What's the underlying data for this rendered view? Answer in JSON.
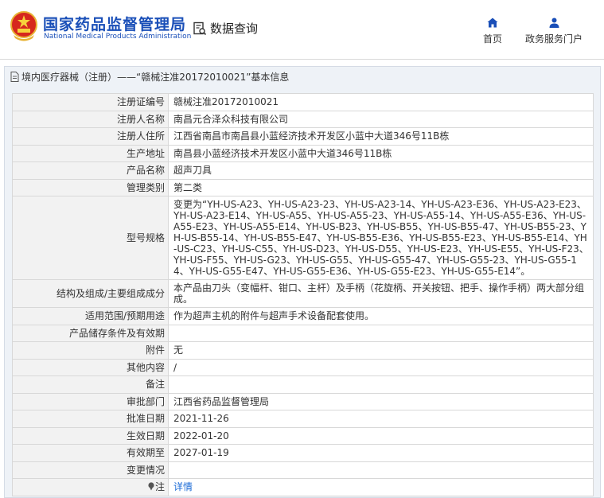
{
  "header": {
    "site_name_cn": "国家药品监督管理局",
    "site_name_en": "National Medical Products Administration",
    "search_label": "数据查询",
    "nav": [
      {
        "label": "首页",
        "icon": "home-icon"
      },
      {
        "label": "政务服务门户",
        "icon": "user-icon"
      }
    ]
  },
  "breadcrumb": {
    "text": "境内医疗器械（注册）——“赣械注准20172010021”基本信息"
  },
  "fields": [
    {
      "label": "注册证编号",
      "value": "赣械注准20172010021"
    },
    {
      "label": "注册人名称",
      "value": "南昌元合泽众科技有限公司"
    },
    {
      "label": "注册人住所",
      "value": "江西省南昌市南昌县小蓝经济技术开发区小蓝中大道346号11B栋"
    },
    {
      "label": "生产地址",
      "value": "南昌县小蓝经济技术开发区小蓝中大道346号11B栋"
    },
    {
      "label": "产品名称",
      "value": "超声刀具"
    },
    {
      "label": "管理类别",
      "value": "第二类"
    },
    {
      "label": "型号规格",
      "value": "变更为“YH-US-A23、YH-US-A23-23、YH-US-A23-14、YH-US-A23-E36、YH-US-A23-E23、YH-US-A23-E14、YH-US-A55、YH-US-A55-23、YH-US-A55-14、YH-US-A55-E36、YH-US-A55-E23、YH-US-A55-E14、YH-US-B23、YH-US-B55、YH-US-B55-47、YH-US-B55-23、YH-US-B55-14、YH-US-B55-E47、YH-US-B55-E36、YH-US-B55-E23、YH-US-B55-E14、YH-US-C23、YH-US-C55、YH-US-D23、YH-US-D55、YH-US-E23、YH-US-E55、YH-US-F23、YH-US-F55、YH-US-G23、YH-US-G55、YH-US-G55-47、YH-US-G55-23、YH-US-G55-14、YH-US-G55-E47、YH-US-G55-E36、YH-US-G55-E23、YH-US-G55-E14”。"
    },
    {
      "label": "结构及组成/主要组成成分",
      "value": "本产品由刀头（变幅杆、钳口、主杆）及手柄（花旋柄、开关按钮、把手、操作手柄）两大部分组成。"
    },
    {
      "label": "适用范围/预期用途",
      "value": "作为超声主机的附件与超声手术设备配套使用。"
    },
    {
      "label": "产品储存条件及有效期",
      "value": ""
    },
    {
      "label": "附件",
      "value": "无"
    },
    {
      "label": "其他内容",
      "value": "/"
    },
    {
      "label": "备注",
      "value": ""
    },
    {
      "label": "审批部门",
      "value": "江西省药品监督管理局"
    },
    {
      "label": "批准日期",
      "value": "2021-11-26"
    },
    {
      "label": "生效日期",
      "value": "2022-01-20"
    },
    {
      "label": "有效期至",
      "value": "2027-01-19"
    },
    {
      "label": "变更情况",
      "value": ""
    }
  ],
  "note": {
    "label": "注",
    "link": "详情"
  },
  "colors": {
    "brand_blue": "#1a4fb8",
    "link_blue": "#1a6ad6",
    "panel_bg": "#eef2f7"
  }
}
